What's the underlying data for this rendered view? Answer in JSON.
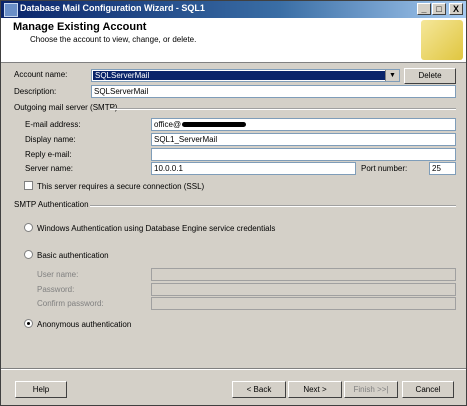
{
  "window": {
    "title": "Database Mail Configuration Wizard - SQL1"
  },
  "header": {
    "title": "Manage Existing Account",
    "subtitle": "Choose the account to view, change, or delete."
  },
  "account": {
    "name_label": "Account name:",
    "name_value": "SQLServerMail",
    "delete_label": "Delete",
    "description_label": "Description:",
    "description_value": "SQLServerMail"
  },
  "smtp": {
    "group_label": "Outgoing mail server (SMTP)",
    "email_label": "E-mail address:",
    "email_value": "office@",
    "display_label": "Display name:",
    "display_value": "SQL1_ServerMail",
    "reply_label": "Reply e-mail:",
    "reply_value": "",
    "server_label": "Server name:",
    "server_value": "10.0.0.1",
    "port_label": "Port number:",
    "port_value": "25",
    "ssl_label": "This server requires a secure connection (SSL)"
  },
  "auth": {
    "group_label": "SMTP Authentication",
    "windows_label": "Windows Authentication using Database Engine service credentials",
    "basic_label": "Basic authentication",
    "user_label": "User name:",
    "password_label": "Password:",
    "confirm_label": "Confirm password:",
    "anonymous_label": "Anonymous authentication",
    "selected": "anonymous"
  },
  "footer": {
    "help": "Help",
    "back": "< Back",
    "next": "Next >",
    "finish": "Finish >>|",
    "cancel": "Cancel"
  },
  "titlebar_buttons": {
    "minimize": "_",
    "maximize": "□",
    "close": "X"
  }
}
